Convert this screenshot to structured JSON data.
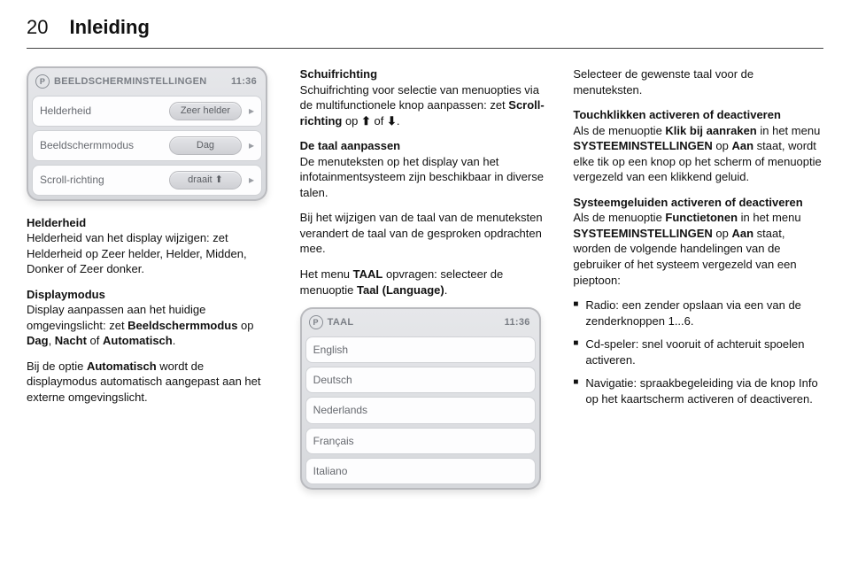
{
  "page": {
    "number": "20",
    "chapter": "Inleiding"
  },
  "device1": {
    "title": "BEELDSCHERMINSTELLINGEN",
    "clock": "11:36",
    "rows": [
      {
        "label": "Helderheid",
        "value": "Zeer helder",
        "chevron": "▸"
      },
      {
        "label": "Beeldschermmodus",
        "value": "Dag",
        "chevron": "▸"
      },
      {
        "label": "Scroll-richting",
        "value": "draait",
        "suffix": "⬆",
        "chevron": "▸"
      }
    ],
    "icons": {
      "header": "P"
    }
  },
  "col1": {
    "helderheid_h": "Helderheid",
    "helderheid_p": "Helderheid van het display wijzigen: zet Helderheid op Zeer helder, Helder, Midden, Donker of Zeer donker.",
    "display_h": "Displaymodus",
    "display_p1_a": "Display aanpassen aan het huidige omgevingslicht: zet ",
    "display_p1_b": "Beeldschermmodus",
    "display_p1_c": " op ",
    "display_p1_d": "Dag",
    "display_p1_e": ", ",
    "display_p1_f": "Nacht",
    "display_p1_g": " of ",
    "display_p1_h": "Automatisch",
    "display_p1_i": ".",
    "display_p2_a": "Bij de optie ",
    "display_p2_b": "Automatisch",
    "display_p2_c": " wordt de displaymodus automatisch aangepast aan het externe omgevingslicht."
  },
  "col2": {
    "schuif_h": "Schuifrichting",
    "schuif_p_a": "Schuifrichting voor selectie van menuopties via de multifunctionele knop aanpassen: zet ",
    "schuif_p_b": "Scroll-richting",
    "schuif_p_c": " op ",
    "schuif_p_d": "⬆",
    "schuif_p_e": " of ",
    "schuif_p_f": "⬇",
    "schuif_p_g": ".",
    "taal_h": "De taal aanpassen",
    "taal_p1": "De menuteksten op het display van het infotainmentsysteem zijn beschikbaar in diverse talen.",
    "taal_p2": "Bij het wijzigen van de taal van de menuteksten verandert de taal van de gesproken opdrachten mee.",
    "taal_p3_a": "Het menu ",
    "taal_p3_b": "TAAL",
    "taal_p3_c": " opvragen: selecteer de menuoptie ",
    "taal_p3_d": "Taal (Language)",
    "taal_p3_e": "."
  },
  "device2": {
    "title": "TAAL",
    "clock": "11:36",
    "rows": [
      {
        "label": "English"
      },
      {
        "label": "Deutsch"
      },
      {
        "label": "Nederlands"
      },
      {
        "label": "Français"
      },
      {
        "label": "Italiano"
      }
    ],
    "icons": {
      "header": "P"
    }
  },
  "col3": {
    "sel_p": "Selecteer de gewenste taal voor de menuteksten.",
    "touch_h": "Touchklikken activeren of deactiveren",
    "touch_p_a": "Als de menuoptie ",
    "touch_p_b": "Klik bij aanraken",
    "touch_p_c": " in het menu ",
    "touch_p_d": "SYSTEEMINSTELLINGEN",
    "touch_p_e": " op ",
    "touch_p_f": "Aan",
    "touch_p_g": " staat, wordt elke tik op een knop op het scherm of menuoptie vergezeld van een klikkend geluid.",
    "sys_h": "Systeemgeluiden activeren of deactiveren",
    "sys_p_a": "Als de menuoptie ",
    "sys_p_b": "Functietonen",
    "sys_p_c": " in het menu ",
    "sys_p_d": "SYSTEEMINSTELLINGEN",
    "sys_p_e": " op ",
    "sys_p_f": "Aan",
    "sys_p_g": " staat, worden de volgende handelingen van de gebruiker of het systeem vergezeld van een pieptoon:",
    "bullets": [
      "Radio: een zender opslaan via een van de zenderknoppen 1...6.",
      "Cd-speler: snel vooruit of achteruit spoelen activeren.",
      "Navigatie: spraakbegeleiding via de knop Info op het kaartscherm activeren of deactiveren."
    ]
  }
}
